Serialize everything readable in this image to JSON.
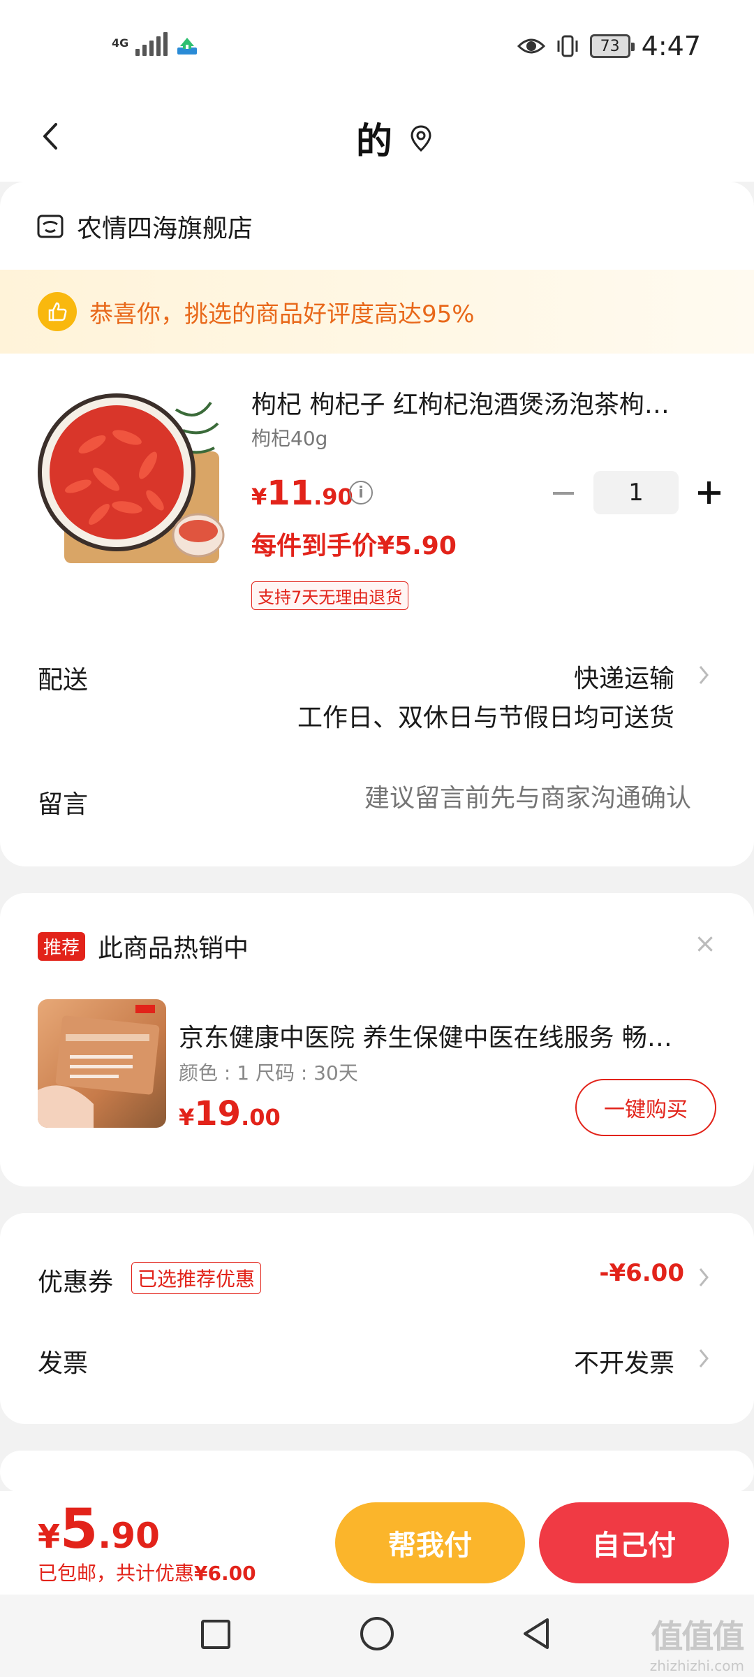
{
  "status_bar": {
    "signal_label": "4G",
    "time": "4:47",
    "battery": "73"
  },
  "header": {
    "title": "的"
  },
  "store": {
    "name": "农情四海旗舰店",
    "praise": "恭喜你，挑选的商品好评度高达95%"
  },
  "product": {
    "title": "枸杞 枸杞子 红枸杞泡酒煲汤泡茶枸…",
    "spec": "枸杞40g",
    "price_currency": "¥",
    "price_int": "11",
    "price_dec": ".90",
    "quantity": "1",
    "hand_price": "每件到手价¥5.90",
    "return_policy": "支持7天无理由退货"
  },
  "delivery": {
    "label": "配送",
    "method": "快递运输",
    "note": "工作日、双休日与节假日均可送货"
  },
  "message": {
    "label": "留言",
    "placeholder": "建议留言前先与商家沟通确认"
  },
  "recommend": {
    "badge": "推荐",
    "title": "此商品热销中",
    "close": "×",
    "name": "京东健康中医院 养生保健中医在线服务 畅…",
    "spec": "颜色 : 1    尺码 : 30天",
    "price_currency": "¥",
    "price_int": "19",
    "price_dec": ".00",
    "buy_label": "一键购买"
  },
  "coupon": {
    "label": "优惠券",
    "tag": "已选推荐优惠",
    "value": "-¥6.00"
  },
  "invoice": {
    "label": "发票",
    "value": "不开发票"
  },
  "checkout": {
    "currency": "¥",
    "total_int": "5",
    "total_dec": ".90",
    "note_prefix": "已包邮，共计优惠",
    "note_amount": "¥6.00",
    "help_pay": "帮我付",
    "self_pay": "自己付"
  },
  "watermark": {
    "logo": "值值值",
    "url": "zhizhizhi.com"
  },
  "colors": {
    "accent_red": "#e2231a",
    "help_yellow": "#fbb52b",
    "self_red": "#f03a44",
    "praise_orange": "#e8681a"
  }
}
